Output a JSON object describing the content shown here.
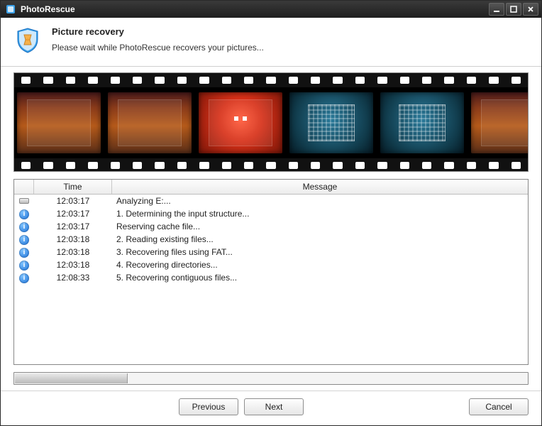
{
  "window": {
    "title": "PhotoRescue"
  },
  "header": {
    "title": "Picture recovery",
    "subtitle": "Please wait while PhotoRescue recovers your pictures..."
  },
  "thumbnails": [
    {
      "style": "warm"
    },
    {
      "style": "warm"
    },
    {
      "style": "red"
    },
    {
      "style": "teal"
    },
    {
      "style": "teal"
    },
    {
      "style": "warm"
    }
  ],
  "log": {
    "columns": {
      "icon": "",
      "time": "Time",
      "message": "Message"
    },
    "rows": [
      {
        "icon": "drive",
        "time": "12:03:17",
        "message": "Analyzing E:..."
      },
      {
        "icon": "info",
        "time": "12:03:17",
        "message": "1. Determining the input structure..."
      },
      {
        "icon": "info",
        "time": "12:03:17",
        "message": "Reserving cache file..."
      },
      {
        "icon": "info",
        "time": "12:03:18",
        "message": "2. Reading existing files..."
      },
      {
        "icon": "info",
        "time": "12:03:18",
        "message": "3. Recovering files using FAT..."
      },
      {
        "icon": "info",
        "time": "12:03:18",
        "message": "4. Recovering directories..."
      },
      {
        "icon": "info",
        "time": "12:08:33",
        "message": "5. Recovering contiguous files..."
      }
    ]
  },
  "progress": {
    "percent": 22
  },
  "buttons": {
    "previous": "Previous",
    "next": "Next",
    "cancel": "Cancel"
  }
}
